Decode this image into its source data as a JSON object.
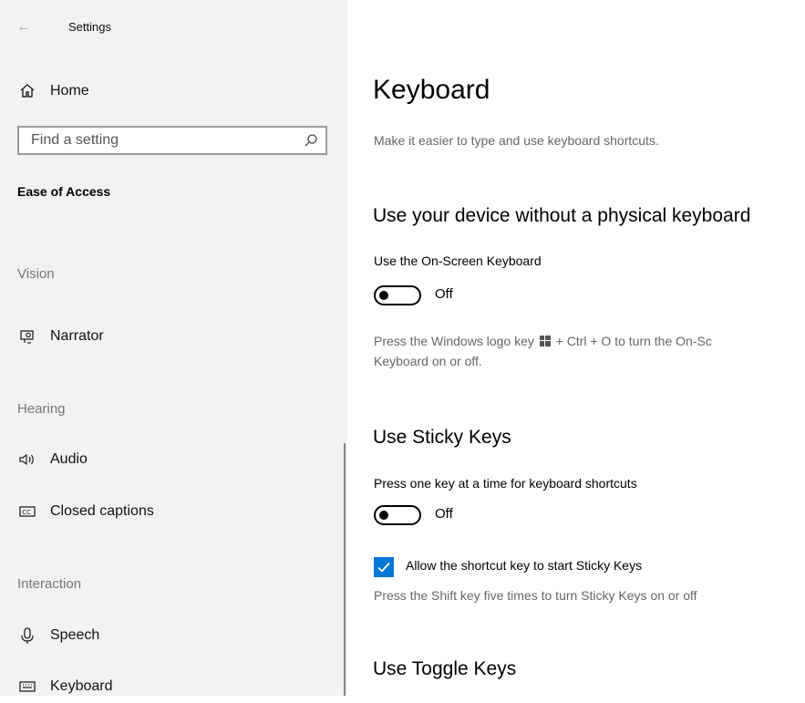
{
  "app": {
    "title": "Settings"
  },
  "sidebar": {
    "home_label": "Home",
    "search_placeholder": "Find a setting",
    "section_title": "Ease of Access",
    "groups": {
      "vision": "Vision",
      "hearing": "Hearing",
      "interaction": "Interaction"
    },
    "items": {
      "narrator": "Narrator",
      "audio": "Audio",
      "closed_captions": "Closed captions",
      "speech": "Speech",
      "keyboard": "Keyboard"
    }
  },
  "main": {
    "title": "Keyboard",
    "subtitle": "Make it easier to type and use keyboard shortcuts.",
    "onscreen": {
      "heading": "Use your device without a physical keyboard",
      "label": "Use the On-Screen Keyboard",
      "state": "Off",
      "desc_line1_a": "Press the Windows logo key",
      "desc_line1_b": "+ Ctrl + O to turn the On-Sc",
      "desc_line2": "Keyboard on or off."
    },
    "sticky": {
      "heading": "Use Sticky Keys",
      "label": "Press one key at a time for keyboard shortcuts",
      "state": "Off",
      "checkbox_label": "Allow the shortcut key to start Sticky Keys",
      "checkbox_checked": true,
      "desc": "Press the Shift key five times to turn Sticky Keys on or off"
    },
    "toggle_keys": {
      "heading": "Use Toggle Keys"
    }
  },
  "colors": {
    "accent": "#0078d7",
    "sidebar_bg": "#f2f2f2",
    "muted_text": "#767676"
  }
}
